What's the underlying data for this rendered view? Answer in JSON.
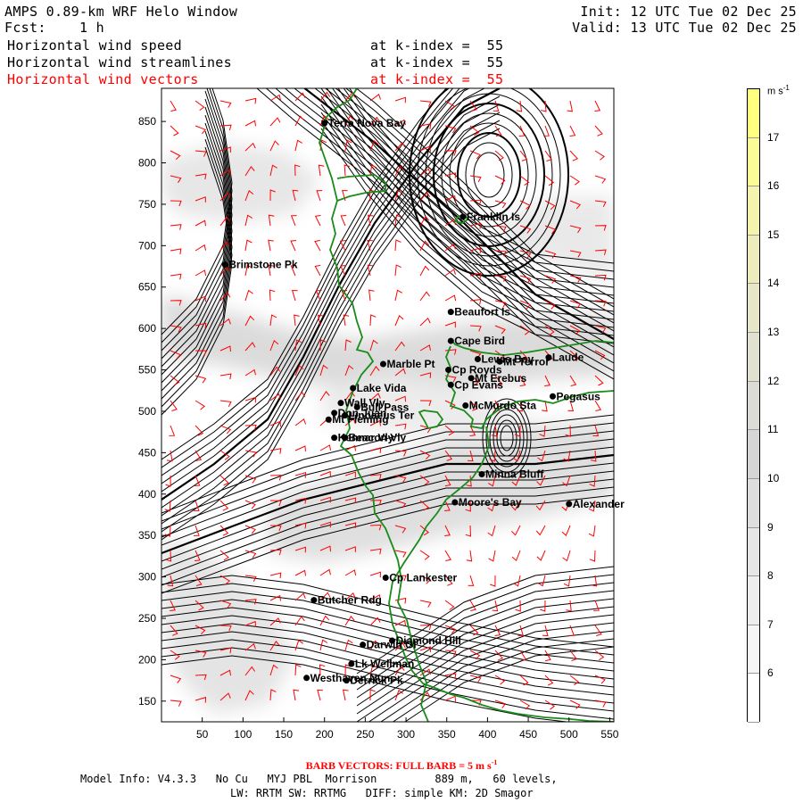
{
  "header": {
    "title": "AMPS 0.89-km WRF Helo Window",
    "fcst_label": "Fcst:",
    "fcst_value": "1 h",
    "init": "Init: 12 UTC Tue 02 Dec 25",
    "valid": "Valid: 13 UTC Tue 02 Dec 25",
    "fields": [
      {
        "name": "Horizontal wind speed",
        "level": "at k-index =  55"
      },
      {
        "name": "Horizontal wind streamlines",
        "level": "at k-index =  55"
      },
      {
        "name": "Horizontal wind vectors",
        "level": "at k-index =  55"
      }
    ]
  },
  "map": {
    "x_ticks": [
      "50",
      "100",
      "150",
      "200",
      "250",
      "300",
      "350",
      "400",
      "450",
      "500",
      "550"
    ],
    "y_ticks": [
      "850",
      "800",
      "750",
      "700",
      "650",
      "600",
      "550",
      "500",
      "450",
      "400",
      "350",
      "300",
      "250",
      "200",
      "150"
    ],
    "x_range": [
      0,
      555
    ],
    "y_range": [
      125,
      890
    ],
    "coastline_color": "#1a8a1a",
    "barb_color": "#ff0000",
    "stations": [
      {
        "name": "Terra Nova Bay",
        "x": 200,
        "y": 848
      },
      {
        "name": "Franklin Is",
        "x": 370,
        "y": 735
      },
      {
        "name": "Brimstone Pk",
        "x": 78,
        "y": 677
      },
      {
        "name": "Beaufort Is",
        "x": 355,
        "y": 620
      },
      {
        "name": "Cape Bird",
        "x": 355,
        "y": 585
      },
      {
        "name": "Lewis Bay",
        "x": 388,
        "y": 563
      },
      {
        "name": "Mt Terror",
        "x": 415,
        "y": 560
      },
      {
        "name": "Laude",
        "x": 475,
        "y": 565
      },
      {
        "name": "Marble Pt",
        "x": 272,
        "y": 557
      },
      {
        "name": "Cp Royds",
        "x": 352,
        "y": 550
      },
      {
        "name": "Mt Erebus",
        "x": 380,
        "y": 540
      },
      {
        "name": "Cp Evans",
        "x": 355,
        "y": 532
      },
      {
        "name": "Lake Vida",
        "x": 235,
        "y": 528
      },
      {
        "name": "Wall Vly",
        "x": 220,
        "y": 510
      },
      {
        "name": "Bull Pass",
        "x": 240,
        "y": 505
      },
      {
        "name": "Don Juan",
        "x": 212,
        "y": 498
      },
      {
        "name": "Mt Fleming",
        "x": 205,
        "y": 490
      },
      {
        "name": "Linnaeus Ter",
        "x": 225,
        "y": 495
      },
      {
        "name": "McMurdo Sta",
        "x": 373,
        "y": 507
      },
      {
        "name": "Pegasus",
        "x": 480,
        "y": 518
      },
      {
        "name": "Kennar Vly",
        "x": 212,
        "y": 468
      },
      {
        "name": "Beacon Vly",
        "x": 225,
        "y": 468
      },
      {
        "name": "Minna Bluff",
        "x": 393,
        "y": 424
      },
      {
        "name": "Moore's Bay",
        "x": 360,
        "y": 390
      },
      {
        "name": "Alexander",
        "x": 500,
        "y": 388
      },
      {
        "name": "Cp Lankester",
        "x": 275,
        "y": 299
      },
      {
        "name": "Butcher Rdg",
        "x": 187,
        "y": 272
      },
      {
        "name": "Darwin Gl",
        "x": 247,
        "y": 218
      },
      {
        "name": "Diamond Hill",
        "x": 283,
        "y": 223
      },
      {
        "name": "Lk Wellman",
        "x": 233,
        "y": 195
      },
      {
        "name": "Westhaven Nun",
        "x": 178,
        "y": 178
      },
      {
        "name": "Derrick Pk",
        "x": 227,
        "y": 175
      }
    ]
  },
  "colorbar": {
    "unit": "m s",
    "unit_exp": "-1",
    "labels": [
      "17",
      "16",
      "15",
      "14",
      "13",
      "12",
      "11",
      "10",
      "9",
      "8",
      "7",
      "6"
    ],
    "colors": [
      "#ffff80",
      "#fbfb98",
      "#f4f4ac",
      "#ededbc",
      "#e7e7c8",
      "#e1e1cf",
      "#dcdcd6",
      "#d6d6d6",
      "#dedede",
      "#e6e6e6",
      "#eeeeee",
      "#f6f6f6",
      "#ffffff"
    ]
  },
  "footer": {
    "barb_note": "BARB VECTORS:  FULL BARB = 5 m s",
    "barb_exp": "-1",
    "model_info": "Model Info: V4.3.3   No Cu   MYJ PBL  Morrison         889 m,   60 levels,",
    "physics": "LW: RRTM SW: RRTMG   DIFF: simple KM: 2D Smagor"
  }
}
